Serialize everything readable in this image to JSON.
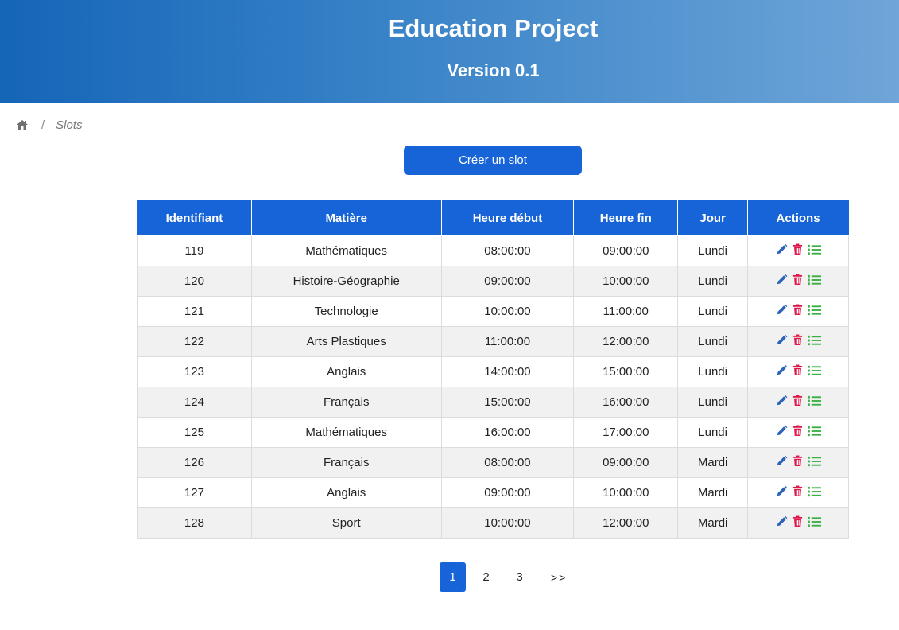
{
  "header": {
    "title": "Education Project",
    "subtitle": "Version 0.1"
  },
  "breadcrumb": {
    "separator": "/",
    "current": "Slots"
  },
  "create_button": "Créer un slot",
  "table": {
    "headers": [
      "Identifiant",
      "Matière",
      "Heure début",
      "Heure fin",
      "Jour",
      "Actions"
    ],
    "rows": [
      [
        "119",
        "Mathématiques",
        "08:00:00",
        "09:00:00",
        "Lundi"
      ],
      [
        "120",
        "Histoire-Géographie",
        "09:00:00",
        "10:00:00",
        "Lundi"
      ],
      [
        "121",
        "Technologie",
        "10:00:00",
        "11:00:00",
        "Lundi"
      ],
      [
        "122",
        "Arts Plastiques",
        "11:00:00",
        "12:00:00",
        "Lundi"
      ],
      [
        "123",
        "Anglais",
        "14:00:00",
        "15:00:00",
        "Lundi"
      ],
      [
        "124",
        "Français",
        "15:00:00",
        "16:00:00",
        "Lundi"
      ],
      [
        "125",
        "Mathématiques",
        "16:00:00",
        "17:00:00",
        "Lundi"
      ],
      [
        "126",
        "Français",
        "08:00:00",
        "09:00:00",
        "Mardi"
      ],
      [
        "127",
        "Anglais",
        "09:00:00",
        "10:00:00",
        "Mardi"
      ],
      [
        "128",
        "Sport",
        "10:00:00",
        "12:00:00",
        "Mardi"
      ]
    ],
    "action_icons": [
      "pencil-icon",
      "trash-icon",
      "list-icon"
    ]
  },
  "pagination": {
    "pages": [
      "1",
      "2",
      "3"
    ],
    "active": "1",
    "next_label": ">>"
  },
  "colors": {
    "primary": "#1763d8",
    "edit_icon": "#2b63b8",
    "delete_icon": "#e0174a",
    "list_icon": "#3cb043"
  }
}
